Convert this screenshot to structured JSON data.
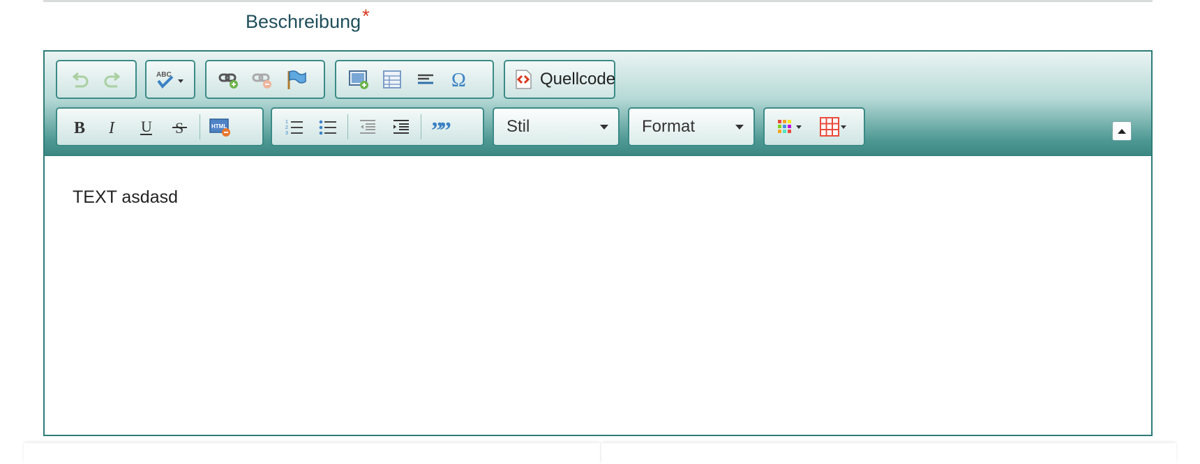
{
  "field": {
    "label": "Beschreibung",
    "required_mark": "*"
  },
  "toolbar": {
    "row1": [
      {
        "group": "history",
        "buttons": [
          {
            "icon": "undo-icon"
          },
          {
            "icon": "redo-icon"
          }
        ]
      },
      {
        "group": "spellcheck",
        "buttons": [
          {
            "icon": "spellcheck-abc-icon"
          }
        ]
      },
      {
        "group": "links",
        "buttons": [
          {
            "icon": "link-icon"
          },
          {
            "icon": "unlink-icon"
          },
          {
            "icon": "anchor-flag-icon"
          }
        ]
      },
      {
        "group": "insert",
        "buttons": [
          {
            "icon": "image-icon"
          },
          {
            "icon": "table-icon"
          },
          {
            "icon": "horizontal-rule-icon"
          },
          {
            "icon": "omega-special-char-icon"
          }
        ]
      },
      {
        "group": "source",
        "buttons": [
          {
            "icon": "source-code-icon",
            "label": "Quellcode"
          }
        ]
      }
    ],
    "row2": [
      {
        "group": "basicstyles",
        "buttons": [
          {
            "icon": "bold-icon"
          },
          {
            "icon": "italic-icon"
          },
          {
            "icon": "underline-icon"
          },
          {
            "icon": "strikethrough-icon"
          },
          {
            "icon": "html-snippet-icon"
          }
        ]
      },
      {
        "group": "paragraph",
        "buttons": [
          {
            "icon": "numbered-list-icon"
          },
          {
            "icon": "bulleted-list-icon"
          },
          {
            "icon": "outdent-icon"
          },
          {
            "icon": "indent-icon"
          },
          {
            "icon": "blockquote-icon"
          }
        ]
      },
      {
        "group": "styles",
        "combos": [
          {
            "label": "Stil"
          },
          {
            "label": "Format"
          }
        ]
      },
      {
        "group": "colors",
        "buttons": [
          {
            "icon": "text-color-icon"
          },
          {
            "icon": "table-color-icon"
          }
        ]
      }
    ],
    "source_label": "Quellcode",
    "style_combo": "Stil",
    "format_combo": "Format"
  },
  "content": {
    "text": "TEXT asdasd"
  },
  "colors": {
    "label": "#1f4e5b",
    "required": "#d9381e",
    "accent": "#2e7b78"
  }
}
